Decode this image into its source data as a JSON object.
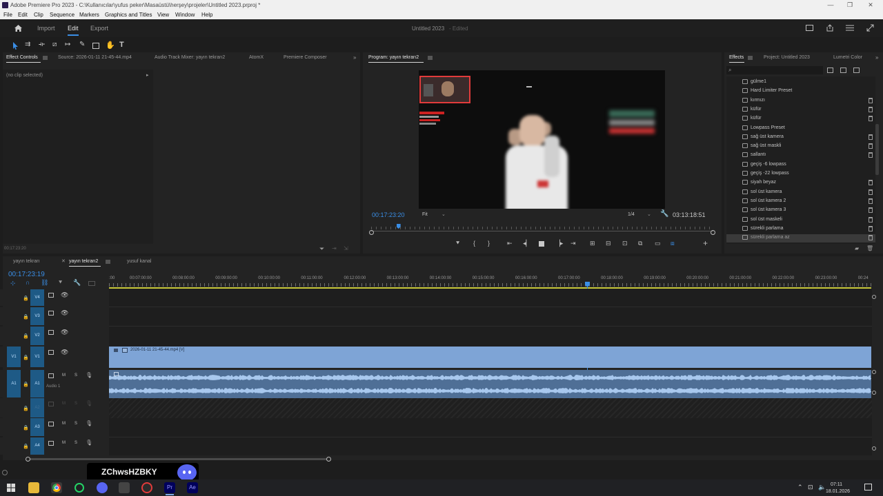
{
  "window": {
    "title": "Adobe Premiere Pro 2023 - C:\\Kullanıcılar\\yufus peker\\Masaüstü\\herşey\\projeler\\Untitled 2023.prproj *"
  },
  "menu": [
    "File",
    "Edit",
    "Clip",
    "Sequence",
    "Markers",
    "Graphics and Titles",
    "View",
    "Window",
    "Help"
  ],
  "header": {
    "import": "Import",
    "edit": "Edit",
    "export": "Export",
    "project_name": "Untitled 2023",
    "edited": "- Edited"
  },
  "source_panel": {
    "tabs": [
      "Effect Controls",
      "Source: 2026-01-11 21-45-44.mp4",
      "Audio Track Mixer: yayın tekrarı2",
      "AtomX",
      "Premiere Composer"
    ],
    "no_clip": "(no clip selected)",
    "timecode": "00:17:23:20"
  },
  "program": {
    "tab": "Program: yayın tekrarı2",
    "timecode": "00:17:23:20",
    "fit": "Fit",
    "resolution": "1/4",
    "duration": "03:13:18:51",
    "playhead": 0.08
  },
  "effects": {
    "tabs": [
      "Effects",
      "Project: Untitled 2023",
      "Lumetri Color"
    ],
    "items": [
      {
        "label": "gülme1",
        "del": false
      },
      {
        "label": "Hard Limiter Preset",
        "del": false
      },
      {
        "label": "kırmızı",
        "del": true
      },
      {
        "label": "küfür",
        "del": true
      },
      {
        "label": "küfür",
        "del": true
      },
      {
        "label": "Lowpass Preset",
        "del": false
      },
      {
        "label": "sağ üst kamera",
        "del": true
      },
      {
        "label": "sağ üst maskli",
        "del": true
      },
      {
        "label": "sallantı",
        "del": true
      },
      {
        "label": "geçiş -6 lowpass",
        "del": false
      },
      {
        "label": "geçiş -22 lowpass",
        "del": false
      },
      {
        "label": "siyah beyaz",
        "del": true
      },
      {
        "label": "sol üst kamera",
        "del": true
      },
      {
        "label": "sol üst kamera 2",
        "del": true
      },
      {
        "label": "sol üst kamera 3",
        "del": true
      },
      {
        "label": "sol üst maskeli",
        "del": true
      },
      {
        "label": "sürekli parlama",
        "del": true
      },
      {
        "label": "sürekli parlama az",
        "del": true
      }
    ]
  },
  "timeline": {
    "tabs": [
      "yayın tekrarı",
      "yayın tekrarı2",
      "yusuf kanal"
    ],
    "timecode": "00:17:23:19",
    "ruler": [
      ":00",
      "00:07:00:00",
      "00:08:00:00",
      "00:09:00:00",
      "00:10:00:00",
      "00:11:00:00",
      "00:12:00:00",
      "00:13:00:00",
      "00:14:00:00",
      "00:15:00:00",
      "00:16:00:00",
      "00:17:00:00",
      "00:18:00:00",
      "00:19:00:00",
      "00:20:00:00",
      "00:21:00:00",
      "00:22:00:00",
      "00:23:00:00",
      "00:24"
    ],
    "tracks": [
      "V4",
      "V3",
      "V2",
      "V1",
      "A1",
      "A2",
      "A3",
      "A4"
    ],
    "clip_name": "2026-01-11 21-45-44.mp4 [V]",
    "audio_label": "Audio 1",
    "m": "M",
    "s": "S"
  },
  "status_tc": "00:17:23:20",
  "overlay": {
    "name": "ZChwsHZBKY"
  },
  "taskbar": {
    "time": "07:11",
    "date": "18.01.2026"
  },
  "colors": {
    "accent": "#3a8ee6",
    "clip_video": "#7ea4d6",
    "clip_audio": "#4f6f96",
    "track_blue": "#1e5a86",
    "discord": "#5865f2"
  }
}
